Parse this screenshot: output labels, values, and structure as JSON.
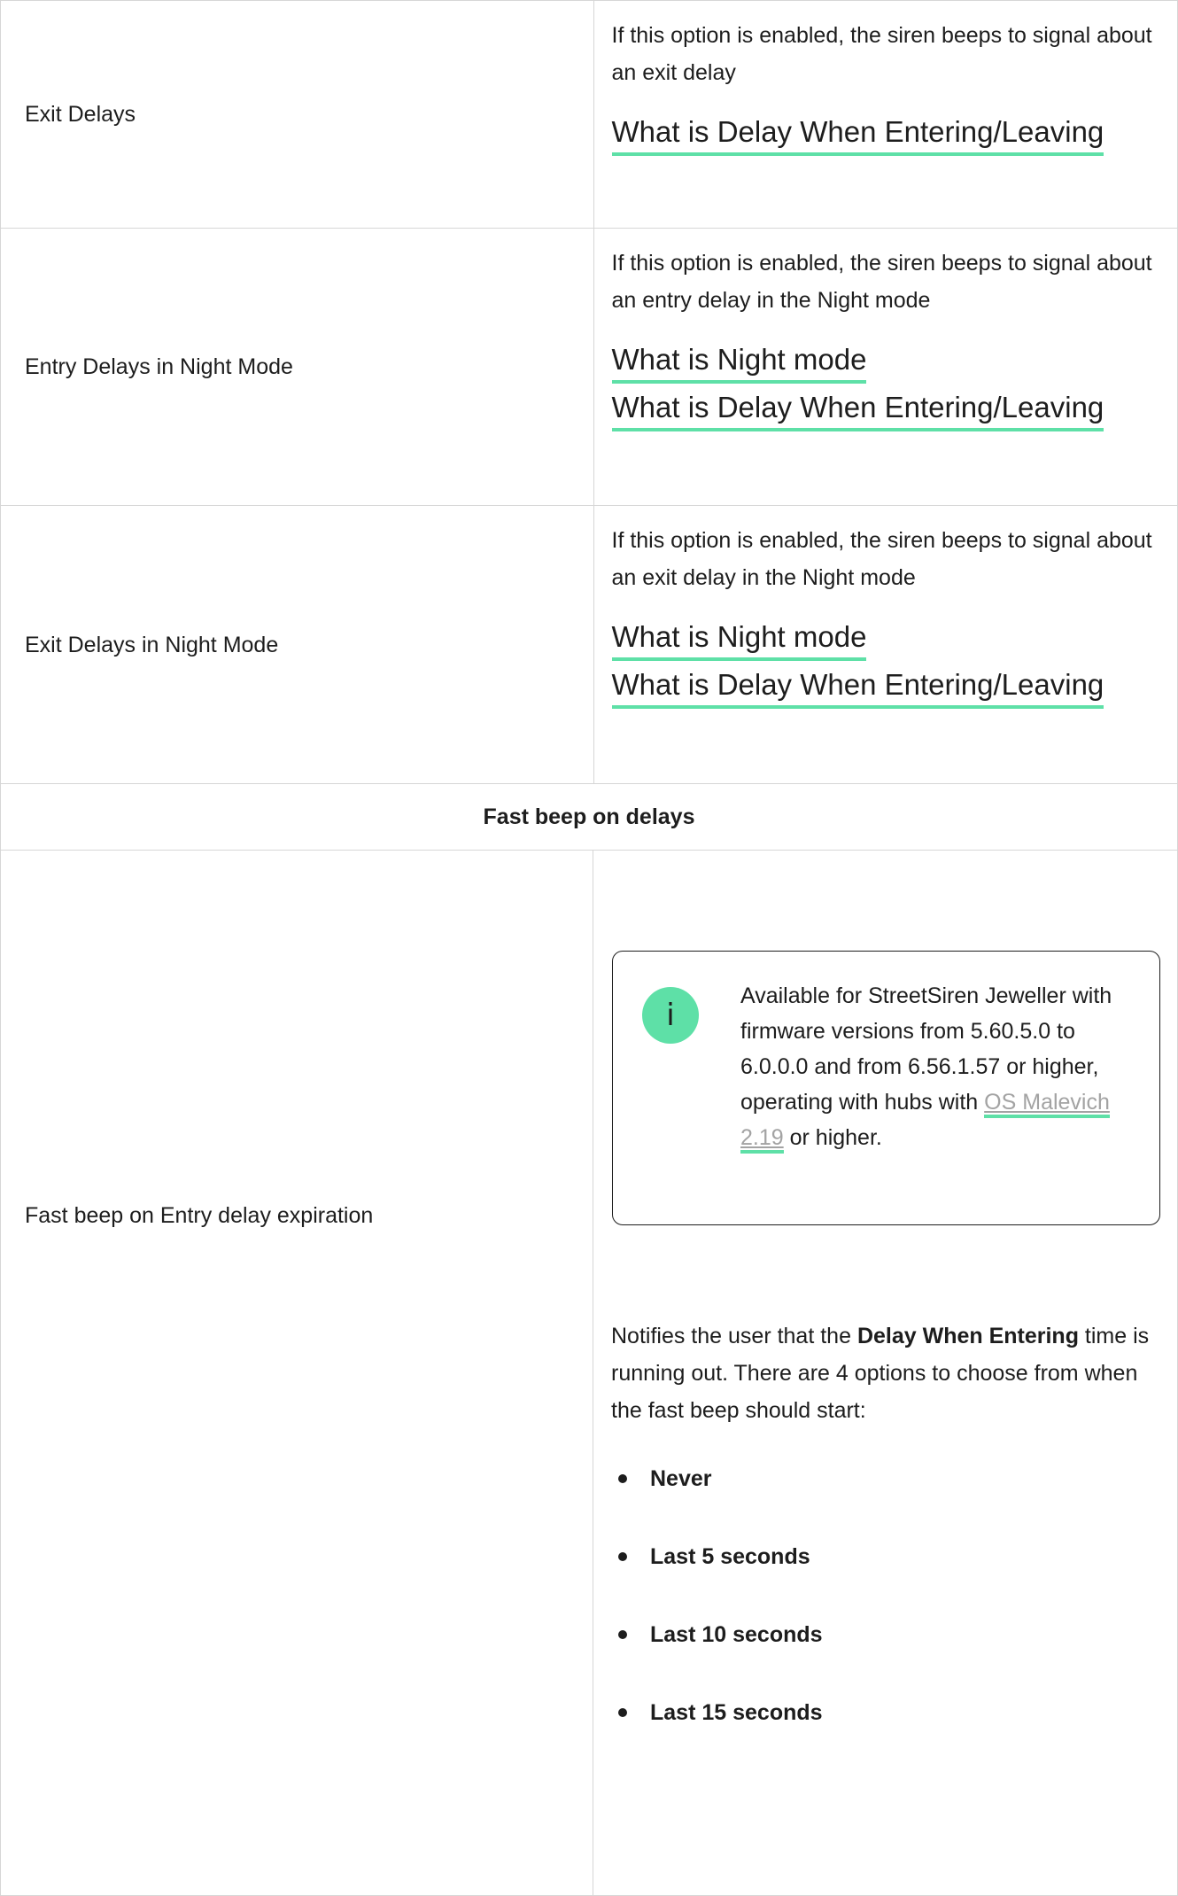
{
  "rows": [
    {
      "label": "Exit Delays",
      "description": "If this option is enabled, the siren beeps to signal about an exit delay",
      "links": [
        "What is Delay When Entering/Leaving"
      ]
    },
    {
      "label": "Entry Delays in Night Mode",
      "description": "If this option is enabled, the siren beeps to signal about an entry delay in the Night mode",
      "links": [
        "What is Night mode",
        "What is Delay When Entering/Leaving"
      ]
    },
    {
      "label": "Exit Delays in Night Mode",
      "description": "If this option is enabled, the siren beeps to signal about an exit delay in the Night mode",
      "links": [
        "What is Night mode",
        "What is Delay When Entering/Leaving"
      ]
    }
  ],
  "section_header": "Fast beep on delays",
  "fast_beep": {
    "label": "Fast beep on Entry delay expiration",
    "note": {
      "icon": "info-icon",
      "icon_glyph": "i",
      "text_before": "Available for StreetSiren Jeweller with firmware versions from 5.60.5.0 to 6.0.0.0 and from 6.56.1.57 or higher, operating with hubs with ",
      "link": "OS Malevich 2.19",
      "text_after": " or higher."
    },
    "desc_prefix": "Notifies the user that the ",
    "desc_bold": "Delay When Entering",
    "desc_suffix": " time is running out. There are 4 options to choose from when the fast beep should start:",
    "options": [
      "Never",
      "Last 5 seconds",
      "Last 10 seconds",
      "Last 15 seconds"
    ]
  },
  "colors": {
    "accent": "#5ee0a7",
    "text": "#1d1d1d",
    "border": "#d6d6d6",
    "muted_link": "#a3a3a3"
  }
}
